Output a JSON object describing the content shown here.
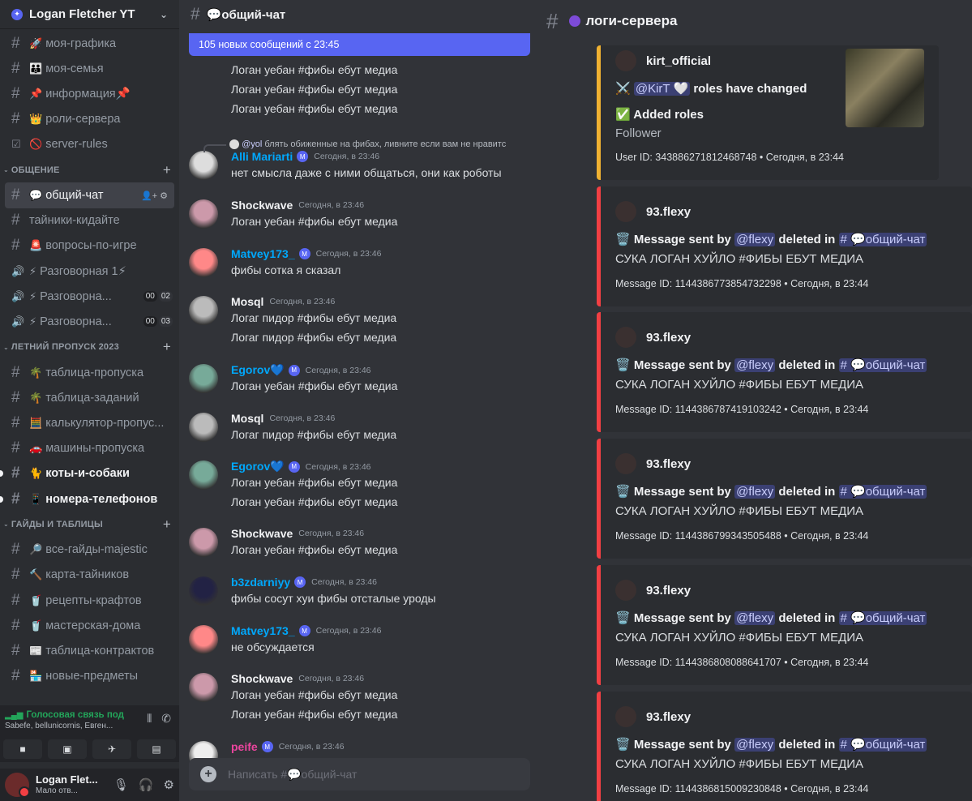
{
  "server": {
    "name": "Logan Fletcher YT"
  },
  "sidebar": {
    "channels": [
      {
        "type": "text",
        "emoji": "🚀",
        "label": "моя-графика"
      },
      {
        "type": "text",
        "emoji": "👪",
        "label": "моя-семья"
      },
      {
        "type": "text",
        "emoji": "📌",
        "label": "информация📌"
      },
      {
        "type": "text",
        "emoji": "👑",
        "label": "роли-сервера"
      },
      {
        "type": "rules",
        "emoji": "🚫",
        "label": "server-rules"
      },
      {
        "type": "category",
        "label": "ОБЩЕНИЕ"
      },
      {
        "type": "text",
        "emoji": "💬",
        "label": "общий-чат",
        "active": true
      },
      {
        "type": "text",
        "emoji": "",
        "label": "тайники-кидайте"
      },
      {
        "type": "text",
        "emoji": "🚨",
        "label": "вопросы-по-игре"
      },
      {
        "type": "voice",
        "emoji": "⚡",
        "label": "Разговорная 1⚡"
      },
      {
        "type": "voice",
        "emoji": "⚡",
        "label": "Разговорна...",
        "count1": "00",
        "count2": "02"
      },
      {
        "type": "voice",
        "emoji": "⚡",
        "label": "Разговорна...",
        "count1": "00",
        "count2": "03"
      },
      {
        "type": "category",
        "label": "ЛЕТНИЙ ПРОПУСК 2023"
      },
      {
        "type": "text",
        "emoji": "🌴",
        "label": "таблица-пропуска"
      },
      {
        "type": "text",
        "emoji": "🌴",
        "label": "таблица-заданий"
      },
      {
        "type": "text",
        "emoji": "🧮",
        "label": "калькулятор-пропус..."
      },
      {
        "type": "text",
        "emoji": "🚗",
        "label": "машины-пропуска"
      },
      {
        "type": "text",
        "emoji": "🐈",
        "label": "коты-и-собаки",
        "unread": true
      },
      {
        "type": "text",
        "emoji": "📱",
        "label": "номера-телефонов",
        "unread": true
      },
      {
        "type": "category",
        "label": "ГАЙДЫ И ТАБЛИЦЫ"
      },
      {
        "type": "text",
        "emoji": "🔎",
        "label": "все-гайды-majestic"
      },
      {
        "type": "text",
        "emoji": "🔨",
        "label": "карта-тайников"
      },
      {
        "type": "text",
        "emoji": "🥤",
        "label": "рецепты-крафтов"
      },
      {
        "type": "text",
        "emoji": "🥤",
        "label": "мастерская-дома"
      },
      {
        "type": "text",
        "emoji": "📰",
        "label": "таблица-контрактов"
      },
      {
        "type": "text",
        "emoji": "🏪",
        "label": "новые-предметы"
      }
    ]
  },
  "voice": {
    "status": "Голосовая связь под",
    "members": "Sabefe, bellunicornis, Евген..."
  },
  "user": {
    "name": "Logan Flet...",
    "status": "Мало отв..."
  },
  "chat": {
    "channel": "💬общий-чат",
    "banner": "105 новых сообщений с 23:45",
    "reply": {
      "mention": "@yol",
      "text": " блять обиженные на фибах, ливните если вам не нравитс"
    },
    "input_placeholder": "Написать #💬общий-чат",
    "top_lines": [
      "Логан уебан #фибы ебут медиа",
      "Логан уебан #фибы ебут медиа",
      "Логан уебан #фибы ебут медиа"
    ],
    "messages": [
      {
        "user": "Alli Mariarti",
        "color": "#00a8fc",
        "badge": true,
        "time": "Сегодня, в 23:46",
        "lines": [
          "нет смысла даже с ними общаться, они как роботы"
        ]
      },
      {
        "user": "Shockwave",
        "color": "#f2f3f5",
        "badge": false,
        "time": "Сегодня, в 23:46",
        "lines": [
          "Логан уебан #фибы ебут медиа"
        ]
      },
      {
        "user": "Matvey173_",
        "color": "#00a8fc",
        "badge": true,
        "time": "Сегодня, в 23:46",
        "lines": [
          "фибы сотка я сказал"
        ]
      },
      {
        "user": "Mosql",
        "color": "#f2f3f5",
        "badge": false,
        "time": "Сегодня, в 23:46",
        "lines": [
          "Логаг пидор #фибы ебут медиа",
          "Логаг пидор #фибы ебут медиа"
        ]
      },
      {
        "user": "Egorov💙",
        "color": "#00a8fc",
        "badge": true,
        "time": "Сегодня, в 23:46",
        "lines": [
          "Логан уебан #фибы ебут медиа"
        ]
      },
      {
        "user": "Mosql",
        "color": "#f2f3f5",
        "badge": false,
        "time": "Сегодня, в 23:46",
        "lines": [
          "Логаг пидор #фибы ебут медиа"
        ]
      },
      {
        "user": "Egorov💙",
        "color": "#00a8fc",
        "badge": true,
        "time": "Сегодня, в 23:46",
        "lines": [
          "Логан уебан #фибы ебут медиа",
          "Логан уебан #фибы ебут медиа"
        ]
      },
      {
        "user": "Shockwave",
        "color": "#f2f3f5",
        "badge": false,
        "time": "Сегодня, в 23:46",
        "lines": [
          "Логан уебан #фибы ебут медиа"
        ]
      },
      {
        "user": "b3zdarniyy",
        "color": "#00a8fc",
        "badge": true,
        "time": "Сегодня, в 23:46",
        "lines": [
          "фибы сосут хуи фибы отсталые уроды"
        ]
      },
      {
        "user": "Matvey173_",
        "color": "#00a8fc",
        "badge": true,
        "time": "Сегодня, в 23:46",
        "lines": [
          "не обсуждается"
        ]
      },
      {
        "user": "Shockwave",
        "color": "#f2f3f5",
        "badge": false,
        "time": "Сегодня, в 23:46",
        "lines": [
          "Логан уебан #фибы ебут медиа",
          "Логан уебан #фибы ебут медиа"
        ]
      },
      {
        "user": "peife",
        "color": "#eb459e",
        "badge": true,
        "time": "Сегодня, в 23:46",
        "lines": []
      }
    ]
  },
  "logs": {
    "channel": "логи-сервера",
    "roles_embed": {
      "author": "kirt_official",
      "line1_prefix": "⚔️",
      "mention": "@KirT 🤍",
      "line1_suffix": " roles have changed",
      "added": "✅ Added roles",
      "role": "Follower",
      "footer": "User ID: 343886271812468748 • Сегодня, в 23:44"
    },
    "delete_embeds": [
      {
        "author": "93.flexy",
        "text": "СУКА ЛОГАН ХУЙЛО #ФИБЫ ЕБУТ МЕДИА",
        "footer": "Message ID: 1144386773854732298 • Сегодня, в 23:44"
      },
      {
        "author": "93.flexy",
        "text": "СУКА ЛОГАН ХУЙЛО #ФИБЫ ЕБУТ МЕДИА",
        "footer": "Message ID: 1144386787419103242 • Сегодня, в 23:44"
      },
      {
        "author": "93.flexy",
        "text": "СУКА ЛОГАН ХУЙЛО #ФИБЫ ЕБУТ МЕДИА",
        "footer": "Message ID: 1144386799343505488 • Сегодня, в 23:44"
      },
      {
        "author": "93.flexy",
        "text": "СУКА ЛОГАН ХУЙЛО #ФИБЫ ЕБУТ МЕДИА",
        "footer": "Message ID: 1144386808088641707 • Сегодня, в 23:44"
      },
      {
        "author": "93.flexy",
        "text": "СУКА ЛОГАН ХУЙЛО #ФИБЫ ЕБУТ МЕДИА",
        "footer": "Message ID: 1144386815009230848 • Сегодня, в 23:44"
      }
    ],
    "delete_line": {
      "prefix": "🗑️ Message sent by ",
      "mention": "@flexy",
      "middle": " deleted in ",
      "channel": "# 💬общий-чат"
    }
  }
}
